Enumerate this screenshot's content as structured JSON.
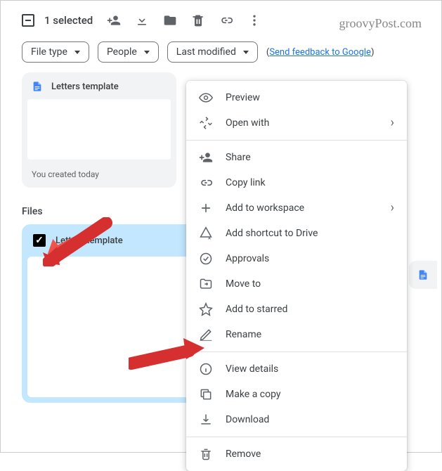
{
  "toolbar": {
    "selection_text": "1 selected"
  },
  "watermark": "groovyPost.com",
  "filters": {
    "filetype": "File type",
    "people": "People",
    "lastmod": "Last modified",
    "feedback_prefix": "(",
    "feedback_link": "Send feedback to Google",
    "feedback_suffix": ")"
  },
  "template_card": {
    "title": "Letters template",
    "footer": "You created today"
  },
  "section_files": "Files",
  "file_card": {
    "title": "Letters template"
  },
  "menu": {
    "preview": "Preview",
    "openwith": "Open with",
    "share": "Share",
    "copylink": "Copy link",
    "addws": "Add to workspace",
    "shortcut": "Add shortcut to Drive",
    "approvals": "Approvals",
    "moveto": "Move to",
    "starred": "Add to starred",
    "rename": "Rename",
    "details": "View details",
    "makecopy": "Make a copy",
    "download": "Download",
    "remove": "Remove"
  }
}
